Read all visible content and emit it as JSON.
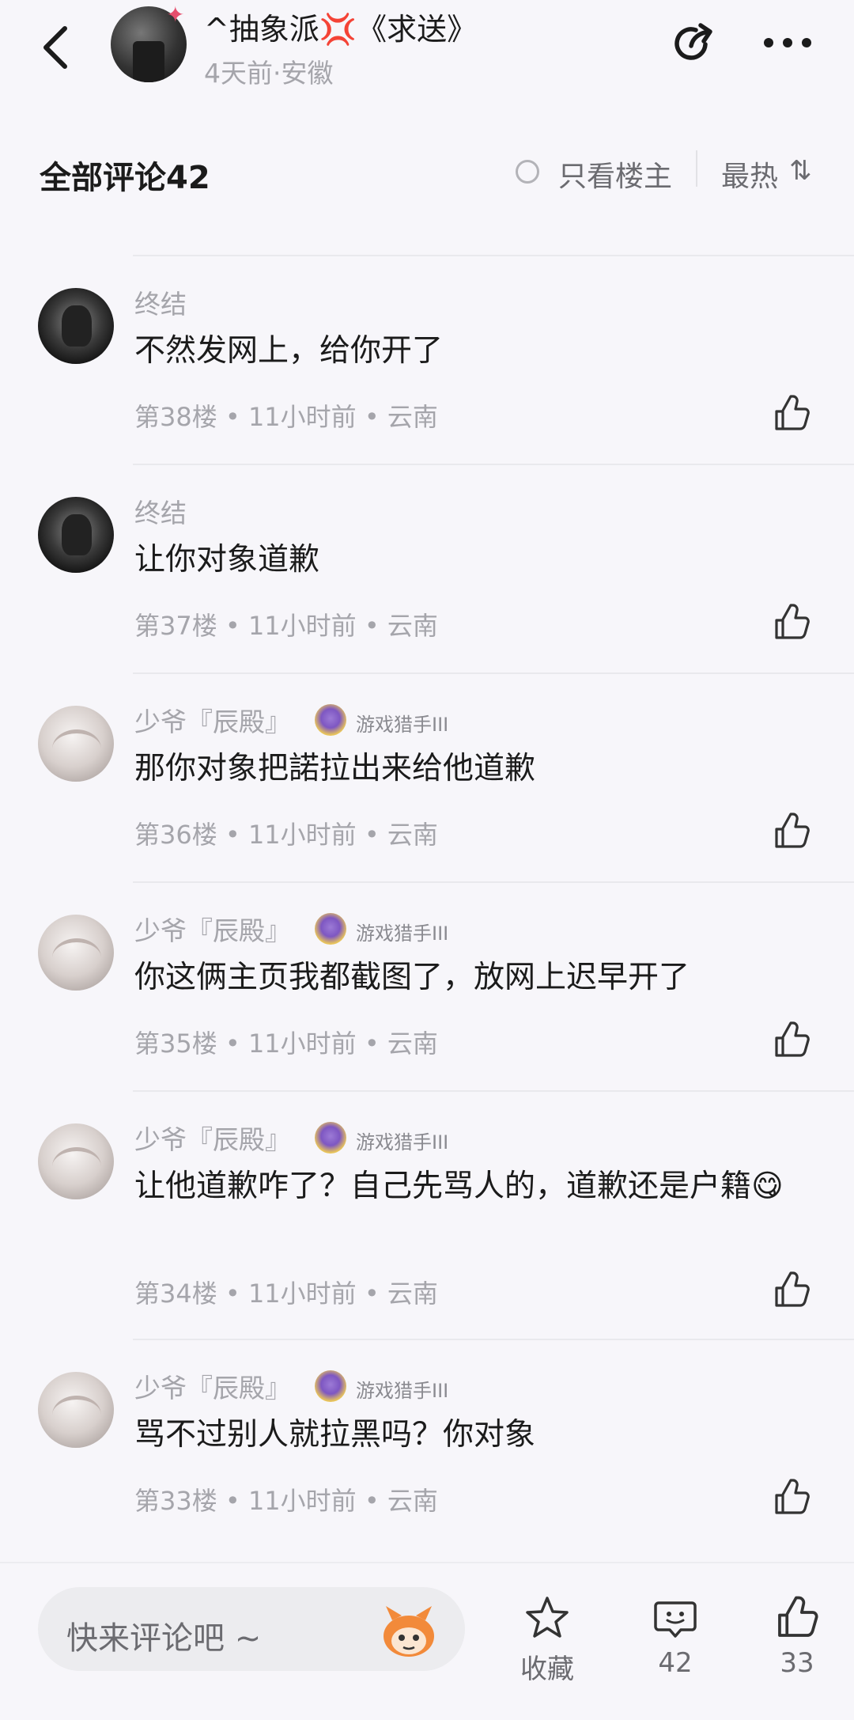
{
  "header": {
    "back_icon": "chevron-left-icon",
    "title": "^抽象派💢《求送》",
    "subtitle": "4天前·安徽",
    "share_icon": "share-icon",
    "more_icon": "more-dots-icon"
  },
  "comments_header": {
    "title": "全部评论42",
    "only_host_label": "只看楼主",
    "sort_label": "最热",
    "sort_icon": "sort-icon"
  },
  "comments": [
    {
      "user": "终结",
      "badge": "",
      "text": "不然发网上，给你开了",
      "meta": "第38楼 • 11小时前 • 云南",
      "avatar": "dark"
    },
    {
      "user": "终结",
      "badge": "",
      "text": "让你对象道歉",
      "meta": "第37楼 • 11小时前 • 云南",
      "avatar": "dark"
    },
    {
      "user": "少爷『辰殿』",
      "badge": "游戏猎手III",
      "text": "那你对象把諾拉出来给他道歉",
      "meta": "第36楼 • 11小时前 • 云南",
      "avatar": "light"
    },
    {
      "user": "少爷『辰殿』",
      "badge": "游戏猎手III",
      "text": "你这俩主页我都截图了，放网上迟早开了",
      "meta": "第35楼 • 11小时前 • 云南",
      "avatar": "light"
    },
    {
      "user": "少爷『辰殿』",
      "badge": "游戏猎手III",
      "text": "让他道歉咋了？自己先骂人的，道歉还是户籍😋",
      "meta": "第34楼 • 11小时前 • 云南",
      "avatar": "light"
    },
    {
      "user": "少爷『辰殿』",
      "badge": "游戏猎手III",
      "text": "骂不过别人就拉黑吗？你对象",
      "meta": "第33楼 • 11小时前 • 云南",
      "avatar": "light"
    }
  ],
  "bottom_bar": {
    "comment_placeholder": "快来评论吧 ~",
    "favorite_label": "收藏",
    "comment_count": "42",
    "like_count": "33"
  }
}
